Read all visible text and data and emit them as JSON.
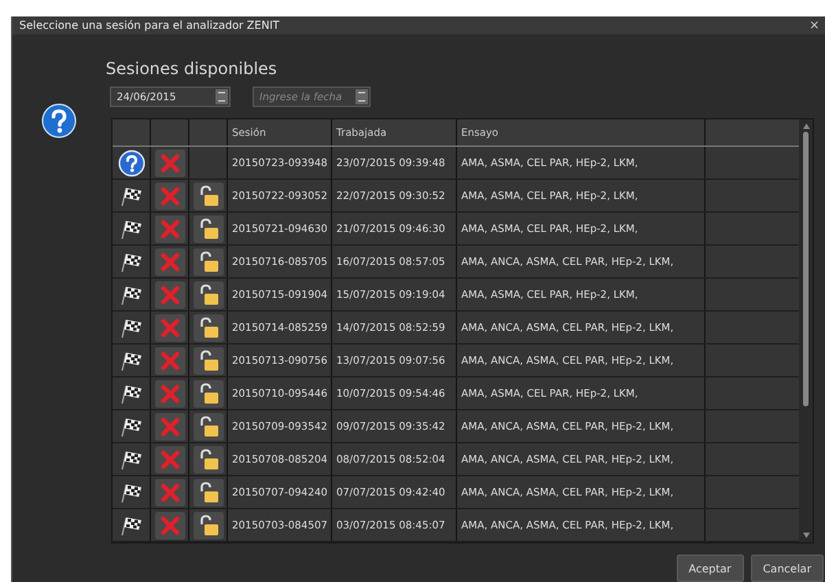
{
  "window": {
    "title": "Seleccione una sesión para el analizador ZENIT",
    "close": "×"
  },
  "heading": "Sesiones disponibles",
  "date_from": {
    "value": "24/06/2015"
  },
  "date_to": {
    "placeholder": "Ingrese la fecha"
  },
  "table": {
    "columns": [
      "Sesión",
      "Trabajada",
      "Ensayo"
    ],
    "rows": [
      {
        "kind": "question",
        "lock": false,
        "session": "20150723-093948",
        "worked": "23/07/2015 09:39:48",
        "tests": "AMA, ASMA, CEL PAR, HEp-2, LKM,"
      },
      {
        "kind": "flag",
        "lock": true,
        "session": "20150722-093052",
        "worked": "22/07/2015 09:30:52",
        "tests": "AMA, ASMA, CEL PAR, HEp-2, LKM,"
      },
      {
        "kind": "flag",
        "lock": true,
        "session": "20150721-094630",
        "worked": "21/07/2015 09:46:30",
        "tests": "AMA, ASMA, CEL PAR, HEp-2, LKM,"
      },
      {
        "kind": "flag",
        "lock": true,
        "session": "20150716-085705",
        "worked": "16/07/2015 08:57:05",
        "tests": "AMA, ANCA, ASMA, CEL PAR, HEp-2, LKM,"
      },
      {
        "kind": "flag",
        "lock": true,
        "session": "20150715-091904",
        "worked": "15/07/2015 09:19:04",
        "tests": "AMA, ASMA, CEL PAR, HEp-2, LKM,"
      },
      {
        "kind": "flag",
        "lock": true,
        "session": "20150714-085259",
        "worked": "14/07/2015 08:52:59",
        "tests": "AMA, ANCA, ASMA, CEL PAR, HEp-2, LKM,"
      },
      {
        "kind": "flag",
        "lock": true,
        "session": "20150713-090756",
        "worked": "13/07/2015 09:07:56",
        "tests": "AMA, ANCA, ASMA, CEL PAR, HEp-2, LKM,"
      },
      {
        "kind": "flag",
        "lock": true,
        "session": "20150710-095446",
        "worked": "10/07/2015 09:54:46",
        "tests": "AMA, ASMA, CEL PAR, HEp-2, LKM,"
      },
      {
        "kind": "flag",
        "lock": true,
        "session": "20150709-093542",
        "worked": "09/07/2015 09:35:42",
        "tests": "AMA, ANCA, ASMA, CEL PAR, HEp-2, LKM,"
      },
      {
        "kind": "flag",
        "lock": true,
        "session": "20150708-085204",
        "worked": "08/07/2015 08:52:04",
        "tests": "AMA, ANCA, ASMA, CEL PAR, HEp-2, LKM,"
      },
      {
        "kind": "flag",
        "lock": true,
        "session": "20150707-094240",
        "worked": "07/07/2015 09:42:40",
        "tests": "AMA, ANCA, ASMA, CEL PAR, HEp-2, LKM,"
      },
      {
        "kind": "flag",
        "lock": true,
        "session": "20150703-084507",
        "worked": "03/07/2015 08:45:07",
        "tests": "AMA, ANCA, ASMA, CEL PAR, HEp-2, LKM,"
      }
    ]
  },
  "buttons": [
    "Aceptar",
    "Cancelar"
  ]
}
